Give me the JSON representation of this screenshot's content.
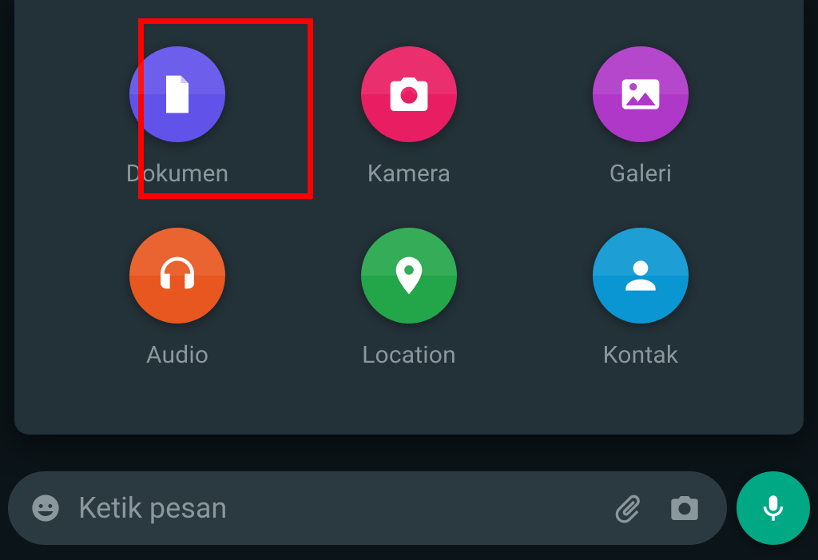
{
  "attachments": {
    "document": {
      "label": "Dokumen",
      "color": "#6152ea",
      "icon": "document-icon"
    },
    "camera": {
      "label": "Kamera",
      "color": "#e91d62",
      "icon": "camera-icon"
    },
    "gallery": {
      "label": "Galeri",
      "color": "#af38c9",
      "icon": "gallery-icon"
    },
    "audio": {
      "label": "Audio",
      "color": "#e8571f",
      "icon": "headphones-icon"
    },
    "location": {
      "label": "Location",
      "color": "#23a54a",
      "icon": "location-pin-icon"
    },
    "contact": {
      "label": "Kontak",
      "color": "#0a96d2",
      "icon": "person-icon"
    }
  },
  "composer": {
    "placeholder": "Ketik pesan",
    "emoji_icon": "emoji-icon",
    "attach_icon": "paperclip-icon",
    "camera_icon": "camera-icon",
    "mic_icon": "mic-icon"
  },
  "highlight_target": "document",
  "theme": {
    "sheet_bg": "#233138",
    "page_bg": "#0b1418",
    "muted_text": "#8a979d",
    "accent": "#00a884"
  }
}
